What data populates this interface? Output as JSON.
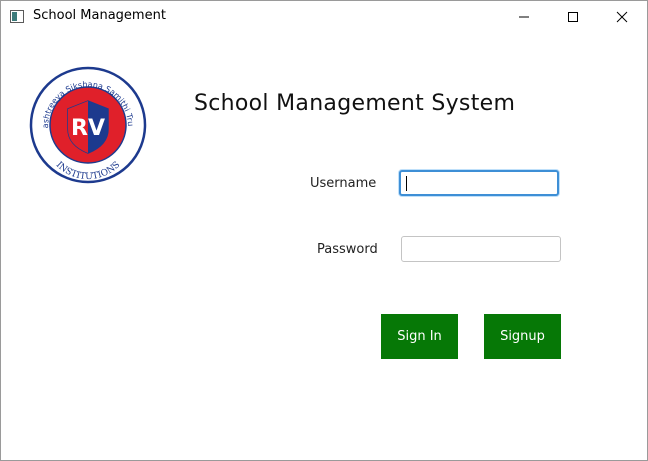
{
  "window": {
    "title": "School Management",
    "controls": [
      "minimize-icon",
      "maximize-icon",
      "close-icon"
    ]
  },
  "logo": {
    "ring_text": "Rashtreeya Sikshana Samithi Trust",
    "center_text": "RV",
    "bottom_text": "INSTITUTIONS",
    "colors": {
      "blue": "#1d3a8e",
      "red": "#e0202a",
      "white": "#ffffff"
    }
  },
  "heading": "School Management System",
  "form": {
    "username_label": "Username",
    "username_value": "",
    "password_label": "Password",
    "password_value": ""
  },
  "buttons": {
    "signin_label": "Sign In",
    "signup_label": "Signup"
  },
  "colors": {
    "button_bg": "#067806",
    "focus_border": "#3e8fd6"
  }
}
